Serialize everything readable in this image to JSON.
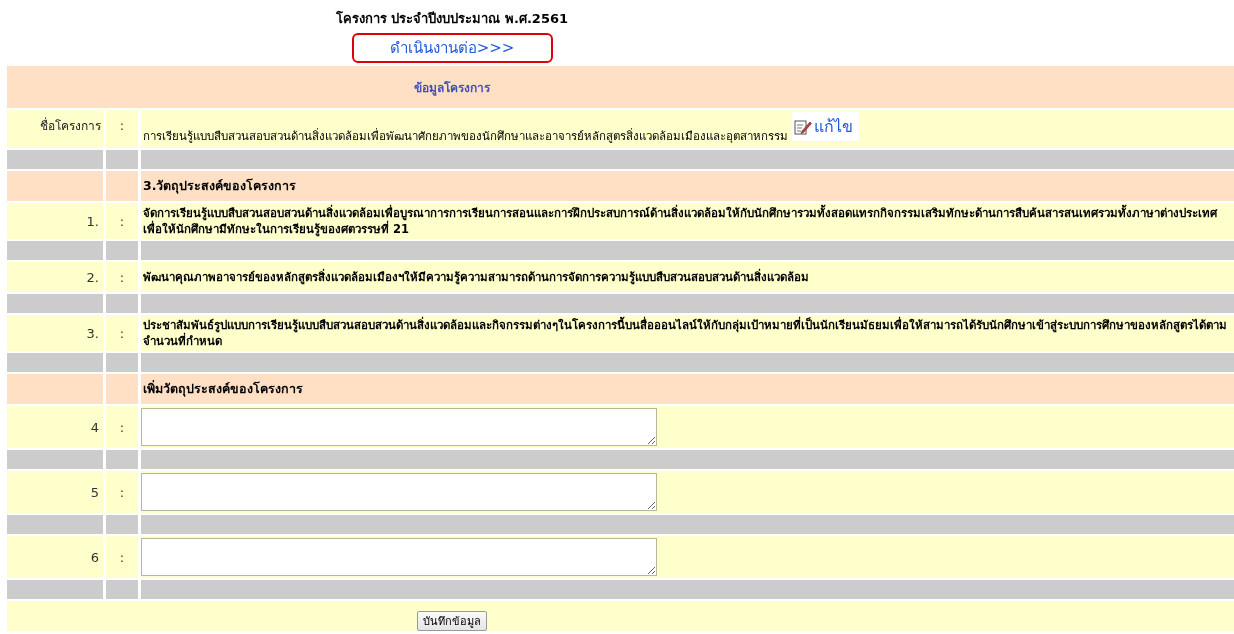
{
  "title": "โครงการ ประจำปีงบประมาณ พ.ศ.2561",
  "continue_link": "ดำเนินงานต่อ>>>",
  "section_header": "ข้อมูลโครงการ",
  "project_name": {
    "label": "ชื่อโครงการ",
    "colon": ":",
    "value": "การเรียนรู้แบบสืบสวนสอบสวนด้านสิ่งแวดล้อมเพื่อพัฒนาศักยภาพของนักศึกษาและอาจารย์หลักสูตรสิ่งแวดล้อมเมืองและอุตสาหกรรม",
    "edit_link": "แก้ไข"
  },
  "objectives_heading": "3.วัตถุประสงค์ของโครงการ",
  "objectives": [
    {
      "number": "1.",
      "colon": ":",
      "text": "จัดการเรียนรู้แบบสืบสวนสอบสวนด้านสิ่งแวดล้อมเพื่อบูรณาการการเรียนการสอนและการฝึกประสบการณ์ด้านสิ่งแวดล้อมให้กับนักศึกษารวมทั้งสอดแทรกกิจกรรมเสริมทักษะด้านการสืบค้นสารสนเทศรวมทั้งภาษาต่างประเทศเพื่อให้นักศึกษามีทักษะในการเรียนรู้ของศตวรรษที่ 21"
    },
    {
      "number": "2.",
      "colon": ":",
      "text": "พัฒนาคุณภาพอาจารย์ของหลักสูตรสิ่งแวดล้อมเมืองฯให้มีความรู้ความสามารถด้านการจัดการความรู้แบบสืบสวนสอบสวนด้านสิ่งแวดล้อม"
    },
    {
      "number": "3.",
      "colon": ":",
      "text": "ประชาสัมพันธ์รูปแบบการเรียนรู้แบบสืบสวนสอบสวนด้านสิ่งแวดล้อมและกิจกรรมต่างๆในโครงการนี้บนสื่อออนไลน์ให้กับกลุ่มเป้าหมายที่เป็นนักเรียนมัธยมเพื่อให้สามารถได้รับนักศึกษาเข้าสู่ระบบการศึกษาของหลักสูตรได้ตามจำนวนที่กำหนด"
    }
  ],
  "add_heading": "เพิ่มวัตถุประสงค์ของโครงการ",
  "new_objectives": [
    {
      "number": "4",
      "colon": ":"
    },
    {
      "number": "5",
      "colon": ":"
    },
    {
      "number": "6",
      "colon": ":"
    }
  ],
  "save_button": "บันทึกข้อมูล"
}
